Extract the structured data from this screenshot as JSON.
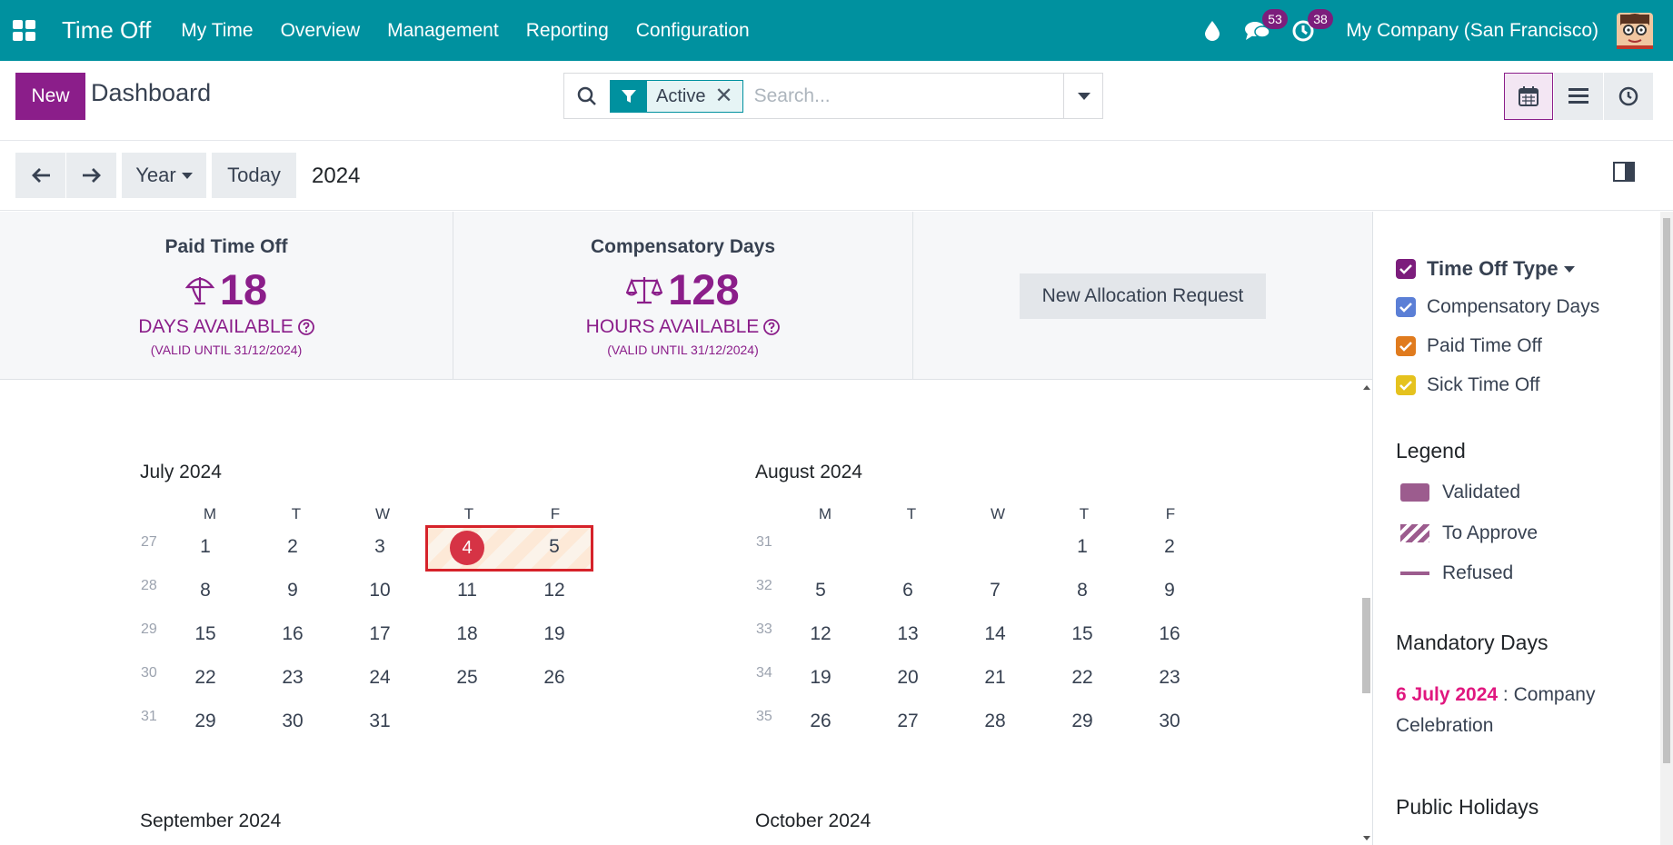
{
  "navbar": {
    "app_title": "Time Off",
    "menu": [
      "My Time",
      "Overview",
      "Management",
      "Reporting",
      "Configuration"
    ],
    "messages_count": "53",
    "activities_count": "38",
    "company": "My Company (San Francisco)",
    "icons": [
      "apps-icon",
      "drop-icon",
      "chat-icon",
      "clock-icon",
      "avatar"
    ]
  },
  "control": {
    "new_label": "New",
    "title": "Dashboard",
    "facet_label": "Active",
    "facet_close": "✕",
    "search_placeholder": "Search..."
  },
  "calendar_controls": {
    "scale_label": "Year",
    "today_label": "Today",
    "period": "2024"
  },
  "summary": {
    "cards": [
      {
        "title": "Paid Time Off",
        "value": "18",
        "unit": "DAYS AVAILABLE",
        "valid": "(VALID UNTIL 31/12/2024)"
      },
      {
        "title": "Compensatory Days",
        "value": "128",
        "unit": "HOURS AVAILABLE",
        "valid": "(VALID UNTIL 31/12/2024)"
      }
    ],
    "allocation_button": "New Allocation Request"
  },
  "calendar": {
    "weekdays": [
      "M",
      "T",
      "W",
      "T",
      "F"
    ],
    "months": [
      {
        "title": "July 2024",
        "weeks": [
          {
            "num": "27",
            "days": [
              "1",
              "2",
              "3",
              "4",
              "5"
            ]
          },
          {
            "num": "28",
            "days": [
              "8",
              "9",
              "10",
              "11",
              "12"
            ]
          },
          {
            "num": "29",
            "days": [
              "15",
              "16",
              "17",
              "18",
              "19"
            ]
          },
          {
            "num": "30",
            "days": [
              "22",
              "23",
              "24",
              "25",
              "26"
            ]
          },
          {
            "num": "31",
            "days": [
              "29",
              "30",
              "31",
              "",
              ""
            ]
          }
        ]
      },
      {
        "title": "August 2024",
        "weeks": [
          {
            "num": "31",
            "days": [
              "",
              "",
              "",
              "1",
              "2"
            ]
          },
          {
            "num": "32",
            "days": [
              "5",
              "6",
              "7",
              "8",
              "9"
            ]
          },
          {
            "num": "33",
            "days": [
              "12",
              "13",
              "14",
              "15",
              "16"
            ]
          },
          {
            "num": "34",
            "days": [
              "19",
              "20",
              "21",
              "22",
              "23"
            ]
          },
          {
            "num": "35",
            "days": [
              "26",
              "27",
              "28",
              "29",
              "30"
            ]
          }
        ]
      },
      {
        "title": "September 2024",
        "weeks": []
      },
      {
        "title": "October 2024",
        "weeks": []
      }
    ],
    "today": "4"
  },
  "sidepanel": {
    "filter_title": "Time Off Type",
    "filters": [
      {
        "label": "Compensatory Days",
        "color": "#5b7fd6"
      },
      {
        "label": "Paid Time Off",
        "color": "#e07b1e"
      },
      {
        "label": "Sick Time Off",
        "color": "#e5c21e"
      }
    ],
    "legend_title": "Legend",
    "legend": [
      "Validated",
      "To Approve",
      "Refused"
    ],
    "mandatory_title": "Mandatory Days",
    "mandatory_date": "6 July 2024",
    "mandatory_text": " : Company Celebration",
    "public_title": "Public Holidays"
  }
}
